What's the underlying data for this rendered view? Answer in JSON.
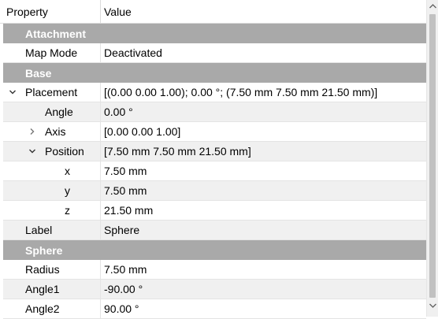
{
  "header": {
    "property": "Property",
    "value": "Value"
  },
  "groups": {
    "attachment": "Attachment",
    "base": "Base",
    "sphere": "Sphere"
  },
  "rows": {
    "map_mode": {
      "name": "Map Mode",
      "value": "Deactivated"
    },
    "placement": {
      "name": "Placement",
      "value": "[(0.00 0.00 1.00); 0.00 °; (7.50 mm  7.50 mm  21.50 mm)]"
    },
    "angle": {
      "name": "Angle",
      "value": "0.00 °"
    },
    "axis": {
      "name": "Axis",
      "value": "[0.00 0.00 1.00]"
    },
    "position": {
      "name": "Position",
      "value": "[7.50 mm  7.50 mm  21.50 mm]"
    },
    "x": {
      "name": "x",
      "value": "7.50 mm"
    },
    "y": {
      "name": "y",
      "value": "7.50 mm"
    },
    "z": {
      "name": "z",
      "value": "21.50 mm"
    },
    "label": {
      "name": "Label",
      "value": "Sphere"
    },
    "radius": {
      "name": "Radius",
      "value": "7.50 mm"
    },
    "angle1": {
      "name": "Angle1",
      "value": "-90.00 °"
    },
    "angle2": {
      "name": "Angle2",
      "value": "90.00 °"
    }
  },
  "icons": {
    "expanded": "chevron-down-icon",
    "collapsed": "chevron-right-icon"
  }
}
